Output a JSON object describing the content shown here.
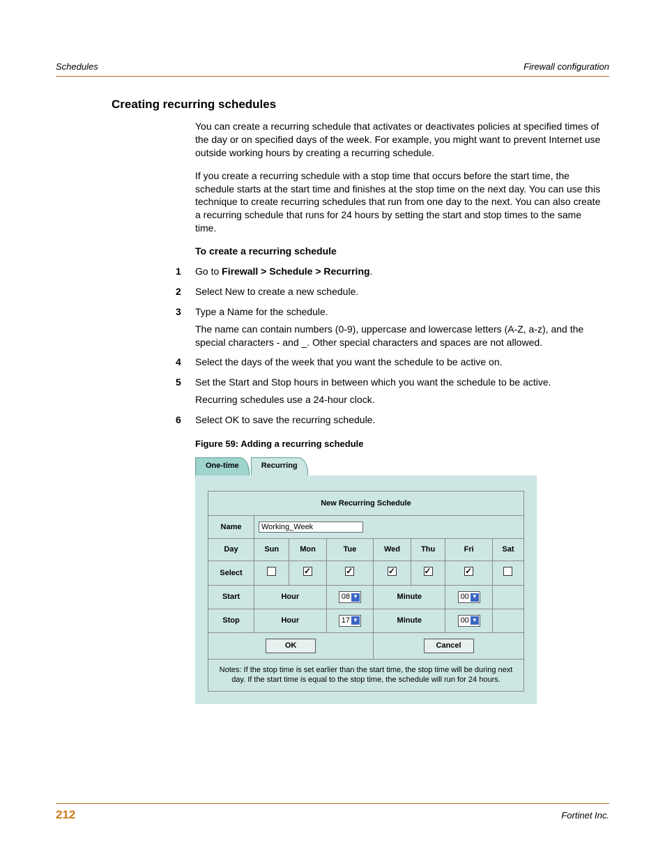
{
  "header": {
    "left": "Schedules",
    "right": "Firewall configuration"
  },
  "section_title": "Creating recurring schedules",
  "paras": {
    "p1": "You can create a recurring schedule that activates or deactivates policies at specified times of the day or on specified days of the week. For example, you might want to prevent Internet use outside working hours by creating a recurring schedule.",
    "p2": "If you create a recurring schedule with a stop time that occurs before the start time, the schedule starts at the start time and finishes at the stop time on the next day. You can use this technique to create recurring schedules that run from one day to the next. You can also create a recurring schedule that runs for 24 hours by setting the start and stop times to the same time."
  },
  "subhead": "To create a recurring schedule",
  "steps": [
    {
      "n": "1",
      "pre": "Go to ",
      "bold": "Firewall > Schedule > Recurring",
      "post": "."
    },
    {
      "n": "2",
      "text": "Select New to create a new schedule."
    },
    {
      "n": "3",
      "text": "Type a Name for the schedule.",
      "extra": "The name can contain numbers (0-9), uppercase and lowercase letters (A-Z, a-z), and the special characters - and _. Other special characters and spaces are not allowed."
    },
    {
      "n": "4",
      "text": "Select the days of the week that you want the schedule to be active on."
    },
    {
      "n": "5",
      "text": "Set the Start and Stop hours in between which you want the schedule to be active.",
      "extra": "Recurring schedules use a 24-hour clock."
    },
    {
      "n": "6",
      "text": "Select OK to save the recurring schedule."
    }
  ],
  "figure": {
    "caption": "Figure 59: Adding a recurring schedule",
    "tabs": {
      "one_time": "One-time",
      "recurring": "Recurring"
    },
    "panel_title": "New Recurring Schedule",
    "labels": {
      "name": "Name",
      "day": "Day",
      "select": "Select",
      "start": "Start",
      "stop": "Stop",
      "hour": "Hour",
      "minute": "Minute"
    },
    "name_value": "Working_Week",
    "days": [
      "Sun",
      "Mon",
      "Tue",
      "Wed",
      "Thu",
      "Fri",
      "Sat"
    ],
    "selected": [
      false,
      true,
      true,
      true,
      true,
      true,
      false
    ],
    "start": {
      "hour": "08",
      "minute": "00"
    },
    "stop": {
      "hour": "17",
      "minute": "00"
    },
    "buttons": {
      "ok": "OK",
      "cancel": "Cancel"
    },
    "notes": "Notes: If the stop time is set earlier than the start time, the stop time will be during next day. If the start time is equal to the stop time, the schedule will run for 24 hours."
  },
  "footer": {
    "page": "212",
    "right": "Fortinet Inc."
  }
}
